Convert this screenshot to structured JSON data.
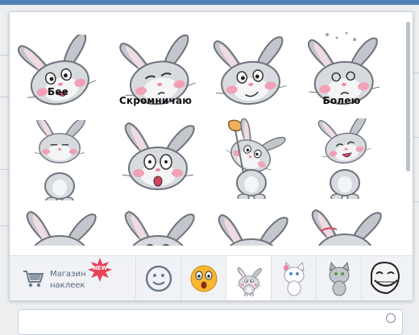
{
  "sticker_picker": {
    "captions": {
      "bee": "Бее",
      "shy": "Скромничаю",
      "sick": "Болею"
    },
    "store": {
      "label_line1": "Магазин",
      "label_line2": "наклеек",
      "badge": "NEW"
    },
    "tabs": [
      {
        "name": "tab-emoji-smiley",
        "icon": "smiley-icon"
      },
      {
        "name": "tab-emoji-shocked",
        "icon": "shocked-face-icon"
      },
      {
        "name": "tab-rabbit-pack",
        "icon": "rabbit-icon",
        "active": true
      },
      {
        "name": "tab-white-cat-pack",
        "icon": "white-cat-icon"
      },
      {
        "name": "tab-grey-cat-pack",
        "icon": "grey-cat-icon"
      },
      {
        "name": "tab-troll-pack",
        "icon": "troll-face-icon"
      }
    ]
  },
  "colors": {
    "brand": "#5181b8",
    "panel_border": "#c5d0db",
    "tab_bar": "#f0f2f5",
    "badge": "#e8415a",
    "rabbit_grey": "#b8bcc2",
    "blush": "#f2a0b5"
  }
}
